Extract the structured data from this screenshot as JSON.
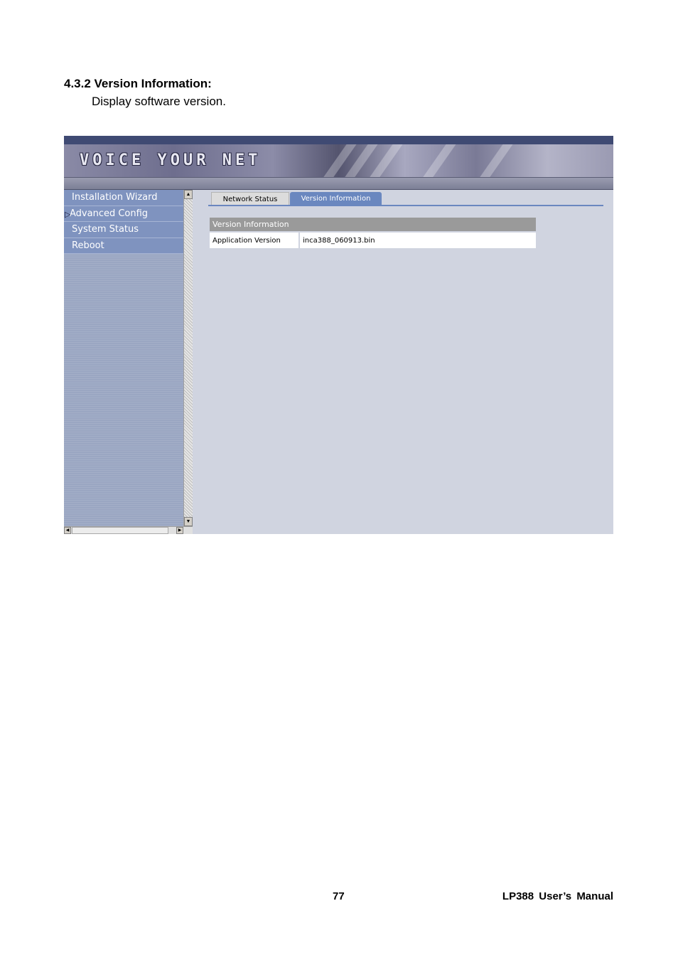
{
  "section": {
    "heading": "4.3.2  Version Information:",
    "description": "Display software version."
  },
  "app": {
    "banner_title": "VOICE YOUR NET",
    "sidebar": {
      "items": [
        {
          "label": "Installation Wizard",
          "active": false
        },
        {
          "label": "Advanced Config",
          "active": true
        },
        {
          "label": "System Status",
          "active": false
        },
        {
          "label": "Reboot",
          "active": false
        }
      ],
      "active_marker": "▷"
    },
    "tabs": [
      {
        "label": "Network Status",
        "selected": false
      },
      {
        "label": "Version Information",
        "selected": true
      }
    ],
    "version_table": {
      "header": "Version Information",
      "rows": [
        {
          "label": "Application Version",
          "value": "inca388_060913.bin"
        }
      ]
    },
    "scrollbar_glyphs": {
      "up": "▲",
      "down": "▼",
      "left": "◀",
      "right": "▶"
    },
    "colors": {
      "menu_bg": "#7f93bf",
      "tab_selected": "#6a87bf",
      "table_header": "#9a9a9a",
      "content_bg": "#d0d4e0"
    }
  },
  "footer": {
    "page_number": "77",
    "manual_name": "LP388  User’s  Manual"
  }
}
